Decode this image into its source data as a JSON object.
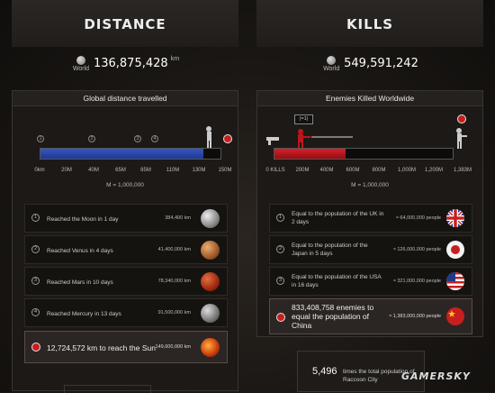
{
  "distance": {
    "title": "DISTANCE",
    "world_label": "World",
    "total": "136,875,428",
    "unit": "km",
    "panel_title": "Global distance travelled",
    "milestone_markers": [
      "1",
      "2",
      "3",
      "4"
    ],
    "progress_fraction": 0.905,
    "ticks": [
      "0km",
      "20M",
      "40M",
      "65M",
      "85M",
      "110M",
      "130M",
      "150M"
    ],
    "scale_note": "M = 1,000,000",
    "rows": [
      {
        "index": "1",
        "label": "Reached the Moon in 1 day",
        "value": "384,400 km",
        "planet": "moon"
      },
      {
        "index": "2",
        "label": "Reached Venus in 4 days",
        "value": "41,400,000 km",
        "planet": "venus"
      },
      {
        "index": "3",
        "label": "Reached Mars in 10 days",
        "value": "78,340,000 km",
        "planet": "mars"
      },
      {
        "index": "4",
        "label": "Reached Mercury in 13 days",
        "value": "91,500,000 km",
        "planet": "mercury"
      }
    ],
    "highlight": {
      "label": "12,724,572 km to reach the Sun",
      "value": "149,600,000 km"
    }
  },
  "kills": {
    "title": "KILLS",
    "world_label": "World",
    "total": "549,591,242",
    "panel_title": "Enemies Killed Worldwide",
    "marker_label": "(=1)",
    "progress_fraction": 0.4,
    "ticks": [
      "0 KILLS",
      "200M",
      "400M",
      "600M",
      "800M",
      "1,000M",
      "1,200M",
      "1,383M"
    ],
    "scale_note": "M = 1,000,000",
    "rows": [
      {
        "index": "1",
        "label": "Equal to the population of the UK in 2 days",
        "value": "≈ 64,000,000 people",
        "flag": "uk"
      },
      {
        "index": "2",
        "label": "Equal to the population of the Japan in 5 days",
        "value": "≈ 126,000,000 people",
        "flag": "japan"
      },
      {
        "index": "3",
        "label": "Equal to the population of the USA in 16 days",
        "value": "≈ 321,000,000 people",
        "flag": "usa"
      }
    ],
    "highlight": {
      "label": "833,408,758 enemies to equal the population of China",
      "value": "≈ 1,383,000,000 people",
      "flag": "china"
    },
    "raccoon": {
      "number": "5,496",
      "text": "times the total population of Raccoon City"
    }
  },
  "watermark": "GAMERSKY",
  "colors": {
    "distance_bar": "#2b4bb0",
    "kills_bar": "#c0141a",
    "pin": "#c81e1e"
  }
}
